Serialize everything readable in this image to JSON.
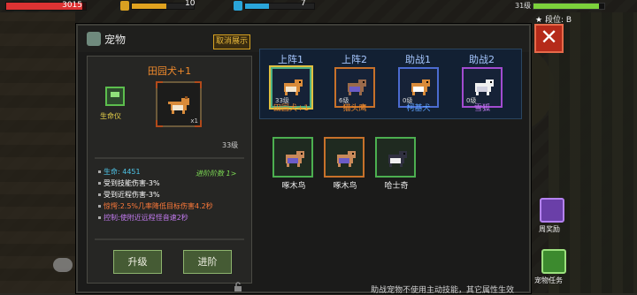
{
  "hud": {
    "hp_text": "3015",
    "hp_ratio": 0.96,
    "armor_text": "10",
    "armor_ratio": 0.55,
    "energy_text": "7",
    "energy_ratio": 0.35,
    "xp_label": "31级",
    "xp_ratio": 0.92,
    "rank_label": "段位: B"
  },
  "panel": {
    "title": "宠物",
    "show_cancel_label": "取消展示",
    "close_label": "✕"
  },
  "selected_pet": {
    "name": "田园犬+1",
    "meter_label": "生命仪",
    "count": "x1",
    "level": "33级",
    "advance_count": "进阶阶数 1>",
    "stats": [
      {
        "text": "生命: 4451",
        "color": "#4ec3e6"
      },
      {
        "text": "受到技能伤害-3%",
        "color": "#ffffff"
      },
      {
        "text": "受到近程伤害-3%",
        "color": "#ffffff"
      },
      {
        "text": "惊愕:2.5%几率降低目标伤害4.2秒",
        "color": "#ff7a3a"
      },
      {
        "text": "控制:使附近远程怪音速2秒",
        "color": "#c27bf0"
      }
    ]
  },
  "buttons": {
    "upgrade": "升级",
    "advance": "进阶"
  },
  "team_slots": [
    {
      "tab": "上阵1",
      "name": "田园犬+1",
      "level": "33级",
      "name_color": "#f08a2c",
      "border": "#4caf84",
      "animal": "dog-icon"
    },
    {
      "tab": "上阵2",
      "name": "猫头鹰",
      "level": "6级",
      "name_color": "#f08a2c",
      "border": "#c7712a",
      "animal": "owl-icon"
    },
    {
      "tab": "助战1",
      "name": "柯基犬",
      "level": "0级",
      "name_color": "#5fa2ff",
      "border": "#4b6bd0",
      "animal": "corgi-icon"
    },
    {
      "tab": "助战2",
      "name": "雪狐",
      "level": "0级",
      "name_color": "#c27bf0",
      "border": "#a24bd0",
      "animal": "fox-icon"
    }
  ],
  "inventory": [
    {
      "name": "啄木鸟",
      "border": "#4caf50",
      "animal": "woodpecker-icon"
    },
    {
      "name": "啄木鸟",
      "border": "#c7712a",
      "animal": "woodpecker-icon"
    },
    {
      "name": "哈士奇",
      "border": "#4caf50",
      "animal": "husky-icon"
    }
  ],
  "bottom_tip": "助战宠物不使用主动技能，其它属性生效",
  "side": {
    "weekly_reward": "周奖励",
    "pet_task": "宠物任务"
  }
}
